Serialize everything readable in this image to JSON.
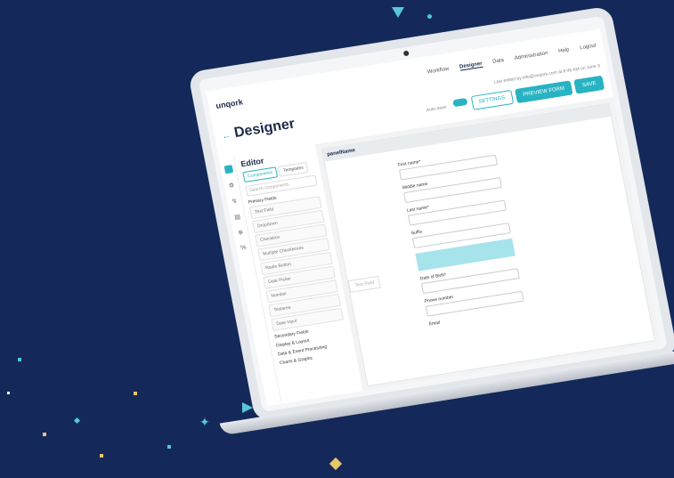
{
  "app": {
    "logo": "unqork",
    "page_title": "Designer",
    "back_arrow": "←"
  },
  "nav": {
    "items": [
      "Workflow",
      "Designer",
      "Data",
      "Administration",
      "Help",
      "Logout"
    ],
    "active_index": 1
  },
  "toolbar": {
    "edited_text": "Last edited by info@unqork.com at 8:45 AM on June 3",
    "toggle_label": "Auto-save",
    "settings_label": "SETTINGS",
    "preview_label": "PREVIEW FORM",
    "save_label": "SAVE"
  },
  "editor": {
    "heading": "Editor",
    "tabs": [
      "Components",
      "Templates"
    ],
    "search_placeholder": "Search components",
    "primary_group": "Primary Fields",
    "components": [
      "Text Field",
      "Dropdown",
      "Checkbox",
      "Multiple Checkboxes",
      "Radio Button",
      "Date Picker",
      "Number",
      "Textarea",
      "Date Input"
    ],
    "secondary_group": "Secondary Fields",
    "secondary": [
      "Display & Layout",
      "Data & Event Processing",
      "Charts & Graphs"
    ]
  },
  "canvas": {
    "panel_title": "panelName",
    "fields": [
      "First name*",
      "Middle name",
      "Last name*",
      "Suffix",
      "Date of Birth*",
      "Phone number",
      "Email"
    ],
    "ghost_label": "Text Field"
  },
  "colors": {
    "accent": "#27b3c2",
    "background": "#14295a",
    "dropzone": "#a6e3ea"
  }
}
